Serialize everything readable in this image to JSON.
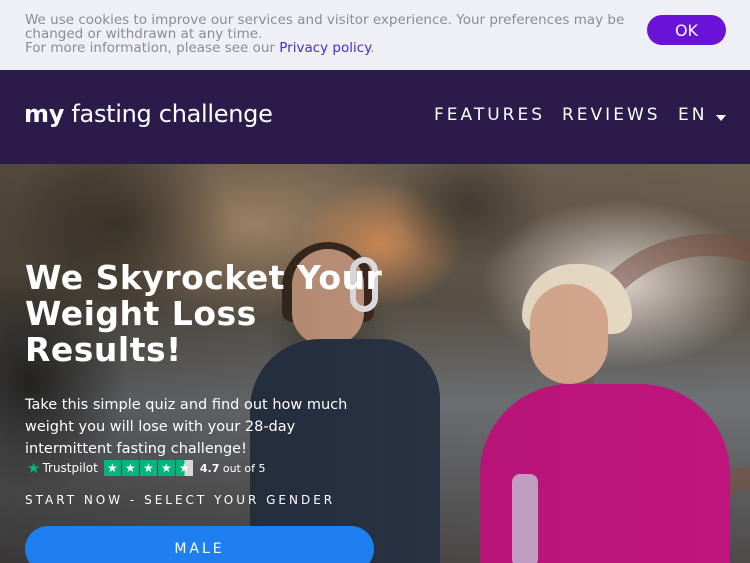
{
  "cookie": {
    "text_line1": "We use cookies to improve our services and visitor experience. Your preferences may be changed or withdrawn at any time.",
    "text_line2_prefix": "For more information, please see our ",
    "privacy_link": "Privacy policy",
    "text_line2_suffix": ".",
    "ok_label": "OK"
  },
  "nav": {
    "logo_my": "my",
    "logo_rest": " fasting challenge",
    "features": "FEATURES",
    "reviews": "REVIEWS",
    "lang": "EN"
  },
  "hero": {
    "title": "We Skyrocket Your Weight Loss Results!",
    "subtitle": "Take this simple quiz and find out how much weight you will lose with your 28-day intermittent fasting challenge!",
    "start_label": "START NOW - SELECT YOUR GENDER",
    "male_label": "MALE"
  },
  "trustpilot": {
    "name": "Trustpilot",
    "rating": "4.7",
    "rating_suffix": "out of 5",
    "stars": 4.5
  },
  "colors": {
    "accent_purple": "#6a12d8",
    "nav_bg": "#2a1b4a",
    "button_blue": "#1f7ff0",
    "trustpilot_green": "#00b67a"
  }
}
